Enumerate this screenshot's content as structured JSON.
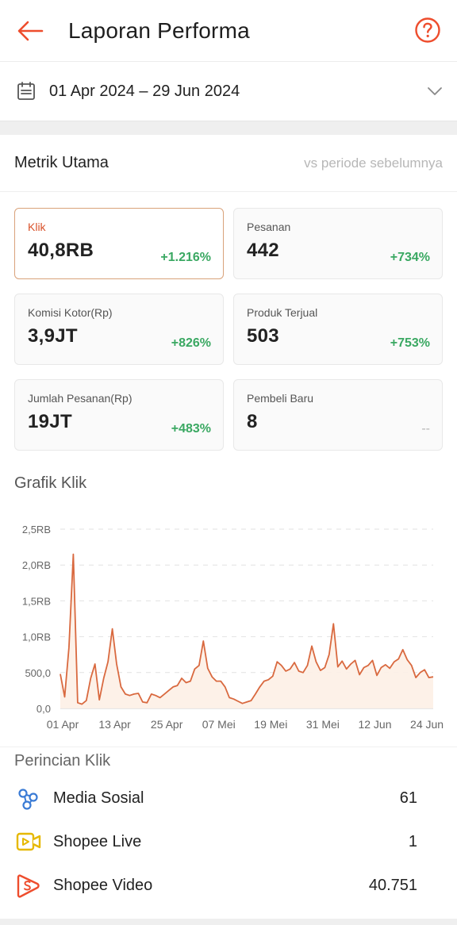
{
  "header": {
    "title": "Laporan Performa",
    "back_icon": "arrow-left-icon",
    "help_icon": "help-circle-icon",
    "accent": "#ee4d2d"
  },
  "date_range": {
    "label": "01 Apr 2024 – 29 Jun 2024"
  },
  "metrics": {
    "title": "Metrik Utama",
    "compare_label": "vs periode sebelumnya",
    "cards": [
      {
        "label": "Klik",
        "value": "40,8RB",
        "change": "+1.216%"
      },
      {
        "label": "Pesanan",
        "value": "442",
        "change": "+734%"
      },
      {
        "label": "Komisi Kotor(Rp)",
        "value": "3,9JT",
        "change": "+826%"
      },
      {
        "label": "Produk Terjual",
        "value": "503",
        "change": "+753%"
      },
      {
        "label": "Jumlah Pesanan(Rp)",
        "value": "19JT",
        "change": "+483%"
      },
      {
        "label": "Pembeli Baru",
        "value": "8",
        "change": "--"
      }
    ]
  },
  "chart_title": "Grafik Klik",
  "chart_data": {
    "type": "area",
    "title": "Grafik Klik",
    "line_color": "#d9693f",
    "fill_color": "#fdf0e6",
    "y_ticks": [
      0,
      500,
      1000,
      1500,
      2000,
      2500
    ],
    "y_tick_labels": [
      "0,0",
      "500,0",
      "1,0RB",
      "1,5RB",
      "2,0RB",
      "2,5RB"
    ],
    "ylim": [
      0,
      2500
    ],
    "x_tick_labels": [
      "01 Apr",
      "13 Apr",
      "25 Apr",
      "07 Mei",
      "19 Mei",
      "31 Mei",
      "12 Jun",
      "24 Jun"
    ],
    "x_tick_positions": [
      0,
      12,
      24,
      36,
      48,
      60,
      72,
      84
    ],
    "series": [
      {
        "values": [
          480,
          160,
          850,
          2150,
          80,
          60,
          110,
          420,
          620,
          120,
          420,
          650,
          1110,
          620,
          300,
          200,
          180,
          200,
          210,
          90,
          80,
          200,
          180,
          150,
          200,
          250,
          300,
          320,
          420,
          360,
          380,
          550,
          600,
          940,
          560,
          440,
          380,
          380,
          300,
          150,
          130,
          100,
          70,
          90,
          110,
          200,
          300,
          380,
          400,
          450,
          650,
          600,
          520,
          550,
          640,
          520,
          500,
          600,
          870,
          650,
          530,
          570,
          750,
          1180,
          580,
          660,
          550,
          620,
          670,
          470,
          570,
          600,
          670,
          460,
          570,
          610,
          560,
          650,
          690,
          820,
          680,
          600,
          430,
          500,
          540,
          430,
          440
        ]
      }
    ]
  },
  "breakdown": {
    "title": "Perincian Klik",
    "items": [
      {
        "label": "Media Sosial",
        "value": "61",
        "icon": "share-nodes-icon"
      },
      {
        "label": "Shopee Live",
        "value": "1",
        "icon": "live-video-icon"
      },
      {
        "label": "Shopee Video",
        "value": "40.751",
        "icon": "shopee-video-icon"
      }
    ]
  }
}
